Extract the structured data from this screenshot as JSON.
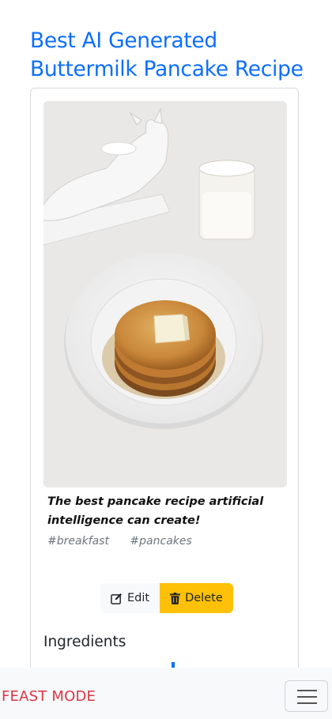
{
  "recipe": {
    "title": "Best AI Generated Buttermilk Pancake Recipe",
    "caption": "The best pancake recipe artificial intelligence can create!",
    "tags": [
      "#breakfast",
      "#pancakes"
    ]
  },
  "actions": {
    "edit_label": "Edit",
    "delete_label": "Delete"
  },
  "ingredients": {
    "heading": "Ingredients"
  },
  "navbar": {
    "brand": "FEAST MODE"
  },
  "colors": {
    "link": "#0d6efd",
    "brand": "#dc3545",
    "delete": "#ffc107"
  }
}
